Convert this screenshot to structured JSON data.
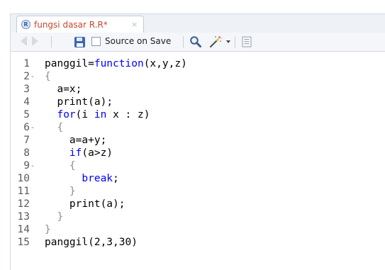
{
  "tab": {
    "icon_letter": "R",
    "label": "fungsi dasar R.R*",
    "close": "×"
  },
  "toolbar": {
    "source_on_save_label": "Source on Save",
    "source_on_save_checked": false
  },
  "editor": {
    "lines": [
      {
        "n": "1",
        "fold": "",
        "indent": "",
        "tokens": [
          [
            "panggil=",
            ""
          ],
          [
            "function",
            "kw"
          ],
          [
            "(x,y,z)",
            ""
          ]
        ]
      },
      {
        "n": "2",
        "fold": "-",
        "indent": "",
        "tokens": [
          [
            "{",
            "br"
          ]
        ]
      },
      {
        "n": "3",
        "fold": "",
        "indent": "  ",
        "tokens": [
          [
            "a=x;",
            ""
          ]
        ]
      },
      {
        "n": "4",
        "fold": "",
        "indent": "  ",
        "tokens": [
          [
            "print",
            ""
          ],
          [
            "(a);",
            ""
          ]
        ]
      },
      {
        "n": "5",
        "fold": "",
        "indent": "  ",
        "tokens": [
          [
            "for",
            "kw"
          ],
          [
            "(i ",
            ""
          ],
          [
            "in",
            "kw"
          ],
          [
            " x : z)",
            ""
          ]
        ]
      },
      {
        "n": "6",
        "fold": "-",
        "indent": "  ",
        "tokens": [
          [
            "{",
            "br"
          ]
        ]
      },
      {
        "n": "7",
        "fold": "",
        "indent": "    ",
        "tokens": [
          [
            "a=a+y;",
            ""
          ]
        ]
      },
      {
        "n": "8",
        "fold": "",
        "indent": "    ",
        "tokens": [
          [
            "if",
            "kw"
          ],
          [
            "(a>z)",
            ""
          ]
        ]
      },
      {
        "n": "9",
        "fold": "-",
        "indent": "    ",
        "tokens": [
          [
            "{",
            "br"
          ]
        ]
      },
      {
        "n": "10",
        "fold": "",
        "indent": "      ",
        "tokens": [
          [
            "break",
            "kw"
          ],
          [
            ";",
            ""
          ]
        ]
      },
      {
        "n": "11",
        "fold": "",
        "indent": "    ",
        "tokens": [
          [
            "}",
            "br"
          ]
        ]
      },
      {
        "n": "12",
        "fold": "",
        "indent": "    ",
        "tokens": [
          [
            "print",
            ""
          ],
          [
            "(a);",
            ""
          ]
        ]
      },
      {
        "n": "13",
        "fold": "",
        "indent": "  ",
        "tokens": [
          [
            "}",
            "br"
          ]
        ]
      },
      {
        "n": "14",
        "fold": "",
        "indent": "",
        "tokens": [
          [
            "}",
            "br"
          ]
        ]
      },
      {
        "n": "15",
        "fold": "",
        "indent": "",
        "tokens": [
          [
            "panggil(2,3,30)",
            ""
          ]
        ]
      }
    ]
  }
}
